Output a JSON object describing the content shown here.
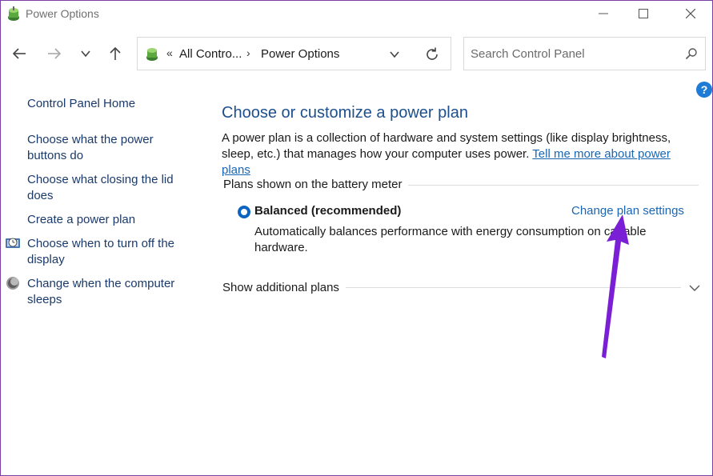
{
  "window": {
    "title": "Power Options"
  },
  "address_bar": {
    "overflow_chevron": "«",
    "crumbs": [
      "All Contro...",
      "Power Options"
    ],
    "separator": "›"
  },
  "search": {
    "placeholder": "Search Control Panel"
  },
  "help": {
    "label": "?"
  },
  "sidebar": {
    "items": [
      {
        "label": "Control Panel Home"
      },
      {
        "label": "Choose what the power buttons do"
      },
      {
        "label": "Choose what closing the lid does"
      },
      {
        "label": "Create a power plan"
      },
      {
        "label": "Choose when to turn off the display",
        "icon": "display-clock-icon"
      },
      {
        "label": "Change when the computer sleeps",
        "icon": "moon-sleep-icon"
      }
    ]
  },
  "main": {
    "heading": "Choose or customize a power plan",
    "description": "A power plan is a collection of hardware and system settings (like display brightness, sleep, etc.) that manages how your computer uses power.",
    "description_link": "Tell me more about power plans",
    "section_label": "Plans shown on the battery meter",
    "plan": {
      "name": "Balanced (recommended)",
      "selected": true,
      "settings_link": "Change plan settings",
      "description": "Automatically balances performance with energy consumption on capable hardware."
    },
    "additional_plans_label": "Show additional plans"
  },
  "colors": {
    "heading": "#1d4f8c",
    "link": "#1a66b3",
    "radio": "#0b64c0",
    "annotation_arrow": "#7b1fd6",
    "window_border": "#7a3fa0"
  },
  "icons": {
    "app": "power-options-icon",
    "back": "back-arrow-icon",
    "forward": "forward-arrow-icon",
    "recent": "chevron-down-icon",
    "up": "up-arrow-icon",
    "refresh": "refresh-icon",
    "search": "search-icon",
    "expand": "chevron-down-icon"
  }
}
